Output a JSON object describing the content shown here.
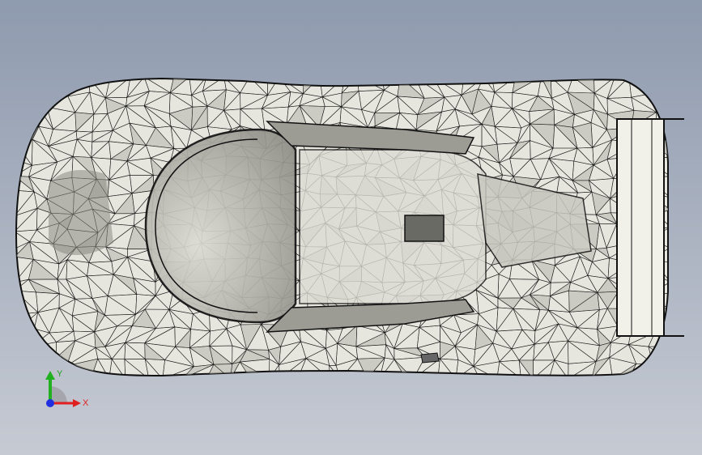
{
  "viewport": {
    "background_top": "#8e9aae",
    "background_bottom": "#c6cad3"
  },
  "model": {
    "icon": "wireframe-car-model-icon",
    "display_mode": "shaded-with-mesh-edges",
    "view": "top",
    "fill_color": "#e9e9e3",
    "shade_color": "#b9b9b1",
    "edge_color": "#111111"
  },
  "triad": {
    "x_label": "X",
    "y_label": "Y",
    "x_color": "#e02020",
    "y_color": "#20b020",
    "z_color": "#2030e0"
  }
}
